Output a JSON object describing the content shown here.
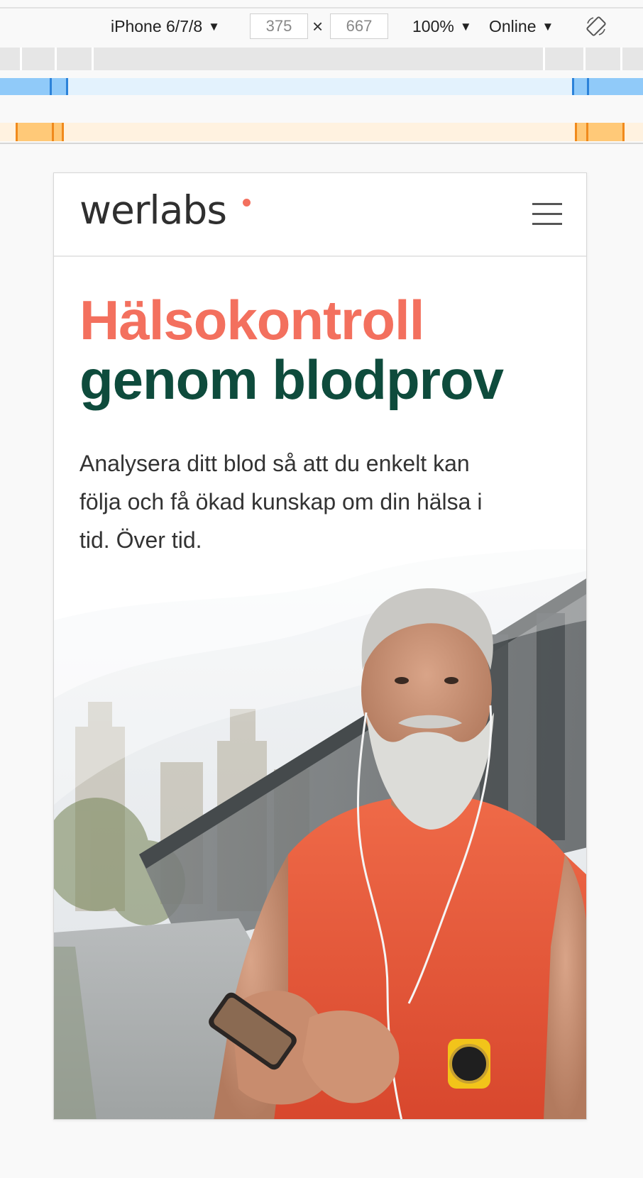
{
  "devtools": {
    "device": "iPhone 6/7/8",
    "width_value": "375",
    "height_value": "667",
    "zoom": "100%",
    "network": "Online"
  },
  "site": {
    "logo": "werlabs",
    "headline_line1": "Hälsokontroll",
    "headline_line2": "genom blodprov",
    "lead": "Analysera ditt blod så att du enkelt kan följa och få ökad kunskap om din hälsa i tid. Över tid."
  },
  "colors": {
    "accent_coral": "#f3705e",
    "headline_green": "#0e4b3c",
    "shirt_orange": "#e8553a"
  },
  "icons": [
    "caret-down-icon",
    "rotate-icon",
    "hamburger-menu-icon"
  ]
}
